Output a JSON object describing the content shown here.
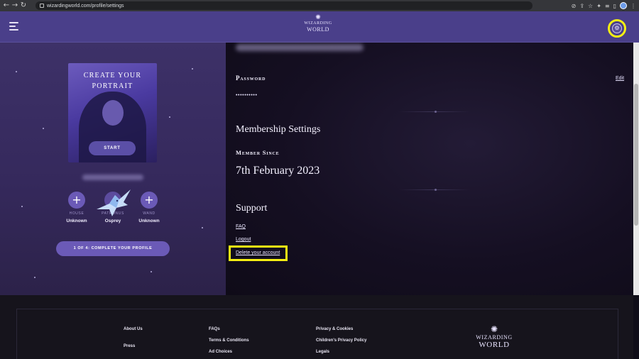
{
  "browser": {
    "url": "wizardingworld.com/profile/settings",
    "back_icon": "back-arrow-icon",
    "forward_icon": "forward-arrow-icon",
    "reload_icon": "reload-icon"
  },
  "header": {
    "brand_line1": "WIZARDING",
    "brand_line2": "WORLD"
  },
  "profile": {
    "portrait_title_line1": "CREATE YOUR",
    "portrait_title_line2": "PORTRAIT",
    "start_label": "START",
    "traits": [
      {
        "label": "HOUSE",
        "value": "Unknown"
      },
      {
        "label": "PATRONUS",
        "value": "Osprey"
      },
      {
        "label": "WAND",
        "value": "Unknown"
      }
    ],
    "progress_label": "1 OF 4: COMPLETE YOUR PROFILE"
  },
  "settings": {
    "password_label": "Password",
    "password_value": "••••••••••",
    "edit_label": "Edit",
    "membership_title": "Membership Settings",
    "member_since_label": "Member Since",
    "member_since_date": "7th February 2023",
    "support_title": "Support",
    "faq_label": "FAQ",
    "logout_label": "Logout",
    "delete_label": "Delete your account"
  },
  "footer": {
    "col1": [
      "About Us",
      "Press"
    ],
    "col2": [
      "FAQs",
      "Terms & Conditions",
      "Ad Choices"
    ],
    "col3": [
      "Privacy & Cookies",
      "Children's Privacy Policy",
      "Legals"
    ],
    "brand_line1": "WIZARDING",
    "brand_line2": "WORLD"
  },
  "colors": {
    "header_bg": "#4a3f8a",
    "highlight": "#f5ef13",
    "panel_bg": "#35295c"
  }
}
